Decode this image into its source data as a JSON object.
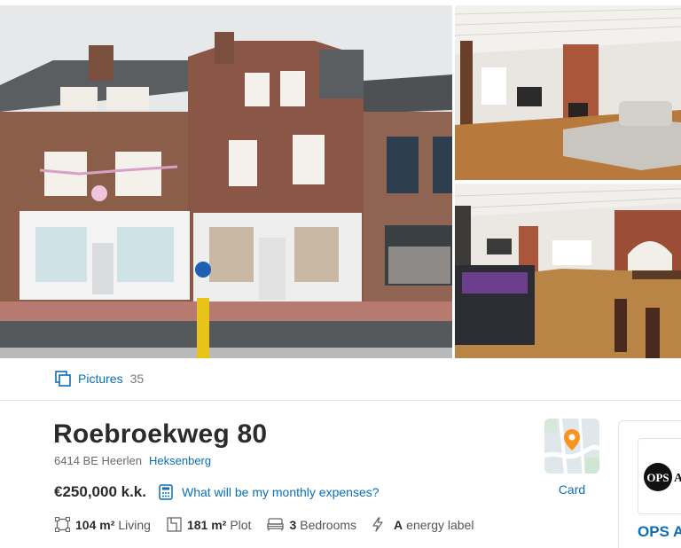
{
  "gallery": {
    "main_photo": "facade-photo",
    "side_photos": [
      "living-room-photo",
      "kitchen-bar-photo"
    ]
  },
  "pictures": {
    "label": "Pictures",
    "count": "35"
  },
  "listing": {
    "address": "Roebroekweg 80",
    "postcode_city": "6414 BE Heerlen",
    "neighbourhood": "Heksenberg",
    "price": "€250,000 k.k.",
    "monthly_expenses_link": "What will be my monthly expenses?",
    "features": {
      "living_value": "104 m²",
      "living_label": "Living",
      "plot_value": "181 m²",
      "plot_label": "Plot",
      "bedrooms_value": "3",
      "bedrooms_label": "Bedrooms",
      "energy_value": "A",
      "energy_label": "energy label"
    }
  },
  "map": {
    "label": "Card",
    "pin_color": "#f7931e"
  },
  "agent": {
    "logo_text": "OPS",
    "logo_suffix": "AI",
    "name": "OPS A"
  },
  "colors": {
    "link": "#0a6fb8",
    "text": "#2b2b2b",
    "muted": "#6b6b6b"
  }
}
